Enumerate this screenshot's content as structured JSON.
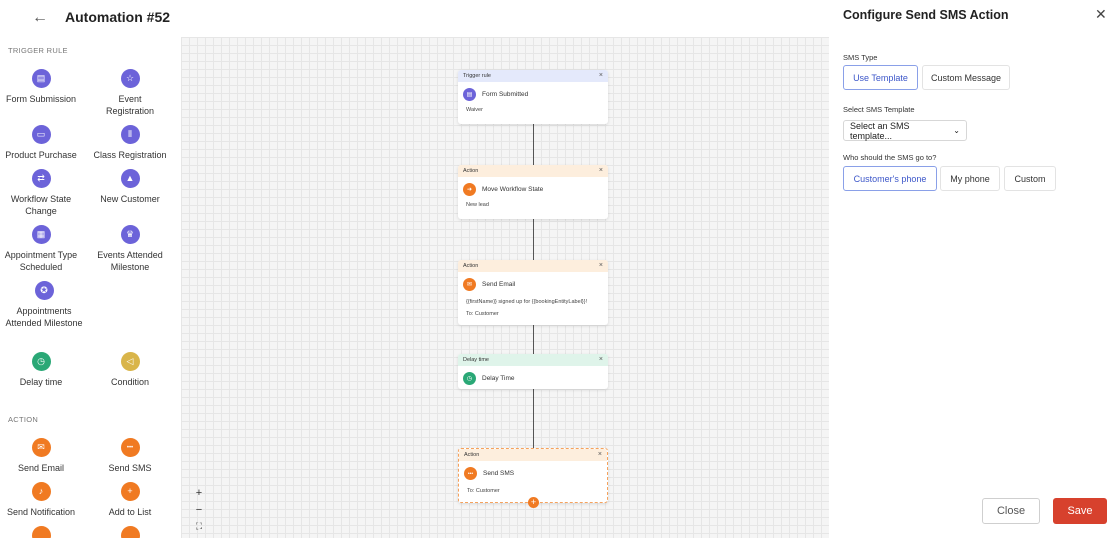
{
  "header": {
    "title": "Automation #52",
    "back_icon": "←"
  },
  "sidebar": {
    "trigger_section": "TRIGGER RULE",
    "triggers": [
      {
        "label": "Form Submission",
        "icon": "▤",
        "color": "#6c63d9"
      },
      {
        "label": "Event Registration",
        "icon": "☆",
        "color": "#6c63d9"
      },
      {
        "label": "Product Purchase",
        "icon": "▭",
        "color": "#6c63d9"
      },
      {
        "label": "Class Registration",
        "icon": "⫴",
        "color": "#6c63d9"
      },
      {
        "label": "Workflow State Change",
        "icon": "⇄",
        "color": "#6c63d9"
      },
      {
        "label": "New Customer",
        "icon": "▲",
        "color": "#6c63d9"
      },
      {
        "label": "Appointment Type Scheduled",
        "icon": "▦",
        "color": "#6c63d9"
      },
      {
        "label": "Events Attended Milestone",
        "icon": "♛",
        "color": "#6c63d9"
      },
      {
        "label": "Appointments Attended Milestone",
        "icon": "✪",
        "color": "#6c63d9"
      },
      {
        "label": "Delay time",
        "icon": "◷",
        "color": "#2aa876"
      },
      {
        "label": "Condition",
        "icon": "◁",
        "color": "#d9b54a"
      }
    ],
    "action_section": "ACTION",
    "actions": [
      {
        "label": "Send Email",
        "icon": "✉",
        "color": "#f07a22"
      },
      {
        "label": "Send SMS",
        "icon": "•••",
        "color": "#f07a22"
      },
      {
        "label": "Send Notification",
        "icon": "♪",
        "color": "#f07a22"
      },
      {
        "label": "Add to List",
        "icon": "+",
        "color": "#f07a22"
      }
    ]
  },
  "canvas": {
    "nodes": [
      {
        "header": "Trigger rule",
        "title": "Form Submitted",
        "detail": "Waiver",
        "extra": ""
      },
      {
        "header": "Action",
        "title": "Move Workflow State",
        "detail": "New lead",
        "extra": ""
      },
      {
        "header": "Action",
        "title": "Send Email",
        "detail": "{{firstName}} signed up for {{bookingEntityLabel}}!",
        "extra": "To: Customer"
      },
      {
        "header": "Delay time",
        "title": "Delay Time",
        "detail": "",
        "extra": ""
      },
      {
        "header": "Action",
        "title": "Send SMS",
        "detail": "To: Customer",
        "extra": ""
      }
    ],
    "zoom": {
      "in": "+",
      "out": "−",
      "fit": "⛶"
    }
  },
  "panel": {
    "title": "Configure Send SMS Action",
    "sms_type_label": "SMS Type",
    "sms_type_options": [
      "Use Template",
      "Custom Message"
    ],
    "template_label": "Select SMS Template",
    "template_placeholder": "Select an SMS template...",
    "recipient_label": "Who should the SMS go to?",
    "recipient_options": [
      "Customer's phone",
      "My phone",
      "Custom"
    ],
    "close_label": "Close",
    "save_label": "Save"
  },
  "colors": {
    "accent": "#3d57c9",
    "save": "#d7412d",
    "trigger": "#6c63d9",
    "action": "#f07a22",
    "delay": "#2aa876",
    "condition": "#d9b54a"
  }
}
